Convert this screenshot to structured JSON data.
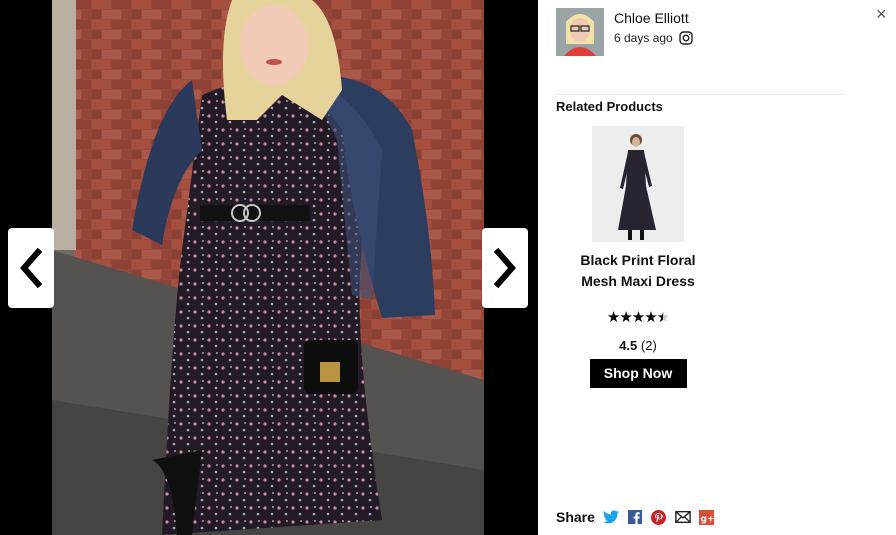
{
  "gallery": {
    "prev_icon": "chevron-left-icon",
    "next_icon": "chevron-right-icon"
  },
  "author": {
    "name": "Chloe Elliott",
    "posted": "6 days ago",
    "source_icon": "instagram-icon"
  },
  "close_label": "×",
  "related": {
    "title": "Related Products",
    "products": [
      {
        "name_line1": "Black Print Floral",
        "name_line2": "Mesh Maxi Dress",
        "stars": "★★★★★",
        "rating": 4.5,
        "rating_value": "4.5",
        "rating_count": "(2)",
        "cta": "Shop Now"
      }
    ]
  },
  "share": {
    "label": "Share",
    "icons": [
      "twitter-icon",
      "facebook-icon",
      "pinterest-icon",
      "email-icon",
      "google-plus-icon"
    ],
    "colors": {
      "twitter": "#1da1f2",
      "facebook": "#3b5998",
      "pinterest": "#cb2027",
      "email": "#222222",
      "google_plus": "#dd4b39"
    }
  }
}
